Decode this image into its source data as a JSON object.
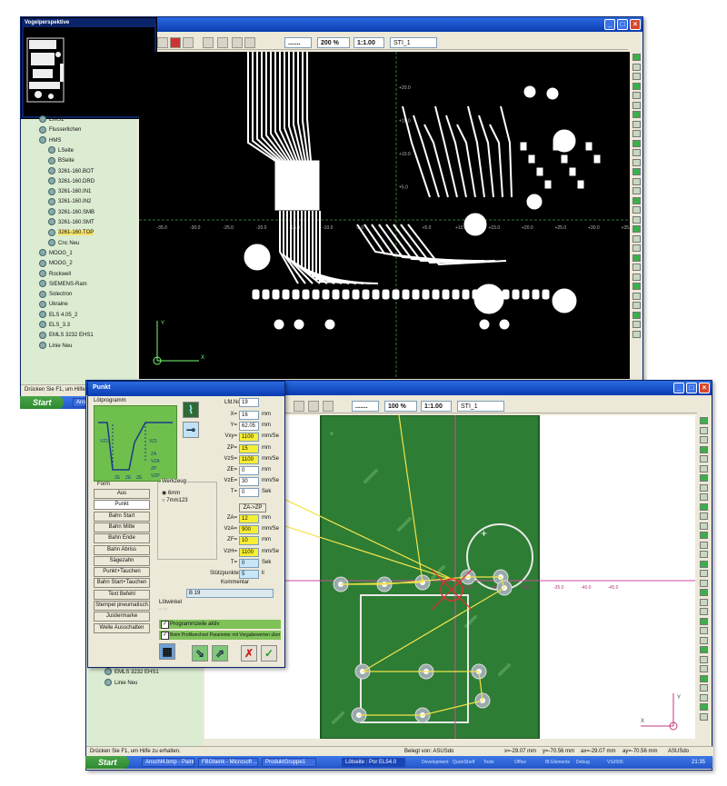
{
  "top_window": {
    "thumbnail_title": "Vogelperspektive",
    "zoom": "200 %",
    "scale": "1:1.00",
    "layer": "STI_1",
    "tree_items": [
      {
        "label": "EMS1",
        "highlight": false
      },
      {
        "label": "Flusserlichen",
        "highlight": false
      },
      {
        "label": "HMS",
        "highlight": false
      },
      {
        "label": "LSeite",
        "highlight": false
      },
      {
        "label": "BSeite",
        "highlight": false
      },
      {
        "label": "3261-160.BOT",
        "highlight": false
      },
      {
        "label": "3261-160.DRD",
        "highlight": false
      },
      {
        "label": "3261-160.IN1",
        "highlight": false
      },
      {
        "label": "3261-160.IN2",
        "highlight": false
      },
      {
        "label": "3261-160.SMB",
        "highlight": false
      },
      {
        "label": "3261-160.SMT",
        "highlight": false
      },
      {
        "label": "3261-160.TOP",
        "highlight": true
      },
      {
        "label": "Cnc Neu",
        "highlight": false
      },
      {
        "label": "MOOG_1",
        "highlight": false
      },
      {
        "label": "MOOG_2",
        "highlight": false
      },
      {
        "label": "Rockwell",
        "highlight": false
      },
      {
        "label": "SIEMENS-Ram",
        "highlight": false
      },
      {
        "label": "Solectron",
        "highlight": false
      },
      {
        "label": "Ukraine",
        "highlight": false
      },
      {
        "label": "ELS 4.05_2",
        "highlight": false
      },
      {
        "label": "ELS_3.3",
        "highlight": false
      },
      {
        "label": "EMLS 3232 EHS1",
        "highlight": false
      },
      {
        "label": "Linie Neu",
        "highlight": false
      }
    ],
    "x_ticks": [
      "-35.0",
      "-30.0",
      "-25.0",
      "-20.0",
      "-15.0",
      "-10.0",
      "-5.0",
      "+5.0",
      "+10.0",
      "+15.0",
      "+20.0",
      "+25.0",
      "+30.0",
      "+35.0"
    ],
    "y_ticks": [
      "+20.0",
      "+15.0",
      "+10.0",
      "+5.0"
    ],
    "axis_y": "Y",
    "axis_x": "X",
    "status": "Drücken Sie F1, um Hilfe zu erh",
    "taskbar_start": "Start",
    "taskbar_items": [
      "Anscl"
    ]
  },
  "bottom_window": {
    "zoom": "100 %",
    "scale": "1:1.00",
    "layer": "STI_1",
    "x_ticks": [
      "+30.0",
      "+25.0",
      "-20.0",
      "-25.0",
      "-30.0",
      "-35.0",
      "-40.0",
      "-45.0"
    ],
    "axis_y": "Y",
    "axis_x": "X",
    "tree_items": [
      "EMLS 3232 EHS1",
      "Linie Neu"
    ],
    "status": "Drücken Sie F1, um Hilfe zu erhalten.",
    "status_right": {
      "belegt": "Belegt von: ASUSdo",
      "coords": [
        "x=-29.07 mm",
        "y=-70.56 mm",
        "ax=-29.07 mm",
        "ay=-70.56 mm",
        "ASUSdo"
      ]
    },
    "taskbar_start": "Start",
    "taskbar_items": [
      "Anschl4.bmp - Paint",
      "FBGbenk - Microsoft ...",
      "ProduktGruppe1",
      "Lötseite : Por EL54.0"
    ],
    "tray_items": [
      "Development",
      "QuickShelf",
      "Tools",
      "Office",
      "IB Elements",
      "Debug",
      "VS2005"
    ],
    "clock": "21:35"
  },
  "dialog": {
    "title": "Punkt",
    "group_loetprogramm": "Lötprogramm",
    "diagram_labels": [
      "VZ1",
      "VZ1",
      "ZA",
      "VZA",
      "ZP",
      "VZP",
      "ZE",
      "ZE",
      "ZE"
    ],
    "lfd_no_label": "Lfd.No.",
    "lfd_no": "19",
    "fields_top": [
      {
        "label": "X=",
        "value": "16",
        "unit": "mm",
        "style": "w"
      },
      {
        "label": "Y=",
        "value": "62.05",
        "unit": "mm",
        "style": "w"
      },
      {
        "label": "Vxy=",
        "value": "1100",
        "unit": "mm/Se",
        "style": "y"
      },
      {
        "label": "ZP=",
        "value": "15",
        "unit": "mm",
        "style": "y"
      },
      {
        "label": "VzS=",
        "value": "1100",
        "unit": "mm/Se",
        "style": "y"
      },
      {
        "label": "ZE=",
        "value": "0",
        "unit": "mm",
        "style": "w"
      },
      {
        "label": "VzE=",
        "value": "30",
        "unit": "mm/Se",
        "style": "w"
      },
      {
        "label": "T=",
        "value": "0",
        "unit": "Sek",
        "style": "w"
      }
    ],
    "za_zp_button": "ZA->ZP",
    "fields_mid": [
      {
        "label": "ZA=",
        "value": "12",
        "unit": "mm",
        "style": "y"
      },
      {
        "label": "VzA=",
        "value": "900",
        "unit": "mm/Se",
        "style": "y"
      },
      {
        "label": "ZF=",
        "value": "10",
        "unit": "mm",
        "style": "y"
      },
      {
        "label": "VzH=",
        "value": "1100",
        "unit": "mm/Se",
        "style": "y"
      },
      {
        "label": "T=",
        "value": "0",
        "unit": "Sek",
        "style": "b"
      },
      {
        "label": "Stützpunkte=",
        "value": "5",
        "unit": "ll",
        "style": "b"
      }
    ],
    "form_label": "Form",
    "form_buttons": [
      "Aus",
      "Punkt",
      "Bahn Start",
      "Bahn Mitte",
      "Bahn Ende",
      "Bahn Abriss",
      "Sägezahn",
      "Punkt+Tauchen",
      "Bahn Start+Tauchen",
      "Text Befehl",
      "Stempel pneumatisch",
      "Justiermarke",
      "Welle Ausschalten"
    ],
    "selected_form": "Punkt",
    "werkzeug_label": "Werkzeug",
    "werkzeug_options": [
      "6mm",
      "7mm123"
    ],
    "kommentar_label": "Kommentar",
    "kommentar_value": "B 19",
    "loetwinkel_label": "Lötwinkel",
    "check1": "Programmzeile aktiv",
    "check2": "Beim Profilwechsel Parameter mit Vorgabewerten über"
  }
}
